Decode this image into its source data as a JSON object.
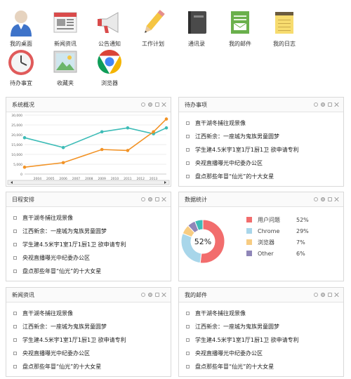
{
  "apps": [
    {
      "label": "我的桌面",
      "icon": "user-avatar-icon"
    },
    {
      "label": "新闻资讯",
      "icon": "newspaper-icon"
    },
    {
      "label": "公告通知",
      "icon": "megaphone-icon"
    },
    {
      "label": "工作计划",
      "icon": "pencil-icon"
    },
    {
      "label": "通讯录",
      "icon": "address-book-icon"
    },
    {
      "label": "我的邮件",
      "icon": "mail-icon"
    },
    {
      "label": "我的日志",
      "icon": "notepad-icon"
    },
    {
      "label": "待办事宜",
      "icon": "clock-icon"
    },
    {
      "label": "收藏夹",
      "icon": "picture-icon"
    },
    {
      "label": "浏览器",
      "icon": "chrome-icon"
    }
  ],
  "items": [
    "直干湖冬捕往观景像",
    "江西新余：一座城为鬼族男童圆梦",
    "学生建4.5米宇1室1厅1厨1卫 欲申请专利",
    "央视直播曝光中纪委办公区",
    "盘点那些年冒“仙光”的十大女星"
  ],
  "panels": {
    "overview": {
      "title": "系统概况"
    },
    "todo": {
      "title": "待办事项"
    },
    "schedule": {
      "title": "日程安排"
    },
    "stats": {
      "title": "数据统计"
    },
    "news": {
      "title": "新闻资讯"
    },
    "mail": {
      "title": "我的邮件"
    }
  },
  "chart_data": [
    {
      "type": "line",
      "x": [
        "2003",
        "2004",
        "2005",
        "2006",
        "2007",
        "2008",
        "2009",
        "2010",
        "2011",
        "2012",
        "2013",
        "2014"
      ],
      "series": [
        {
          "name": "",
          "color": "#3dbcb7",
          "values": [
            18500,
            null,
            null,
            13500,
            null,
            null,
            21500,
            null,
            23500,
            null,
            20500,
            23500
          ]
        },
        {
          "name": "",
          "color": "#f29326",
          "values": [
            3500,
            null,
            null,
            5800,
            null,
            null,
            12500,
            null,
            12000,
            null,
            21500,
            28000
          ]
        }
      ],
      "y_ticks": [
        "30,000",
        "25,000",
        "20,000",
        "15,000",
        "10,000",
        "5,000",
        "0"
      ],
      "x_ticks": [
        "2004",
        "2005",
        "2006",
        "2007",
        "2008",
        "2009",
        "2010",
        "2011",
        "2012",
        "2013"
      ],
      "ylim": [
        0,
        30000
      ],
      "grid": true,
      "title": "",
      "xlabel": "",
      "ylabel": ""
    },
    {
      "type": "pie",
      "center_label": "52%",
      "slices": [
        {
          "name": "用户问题",
          "value": 52,
          "label": "52%",
          "color": "#f26d6d"
        },
        {
          "name": "Chrome",
          "value": 29,
          "label": "29%",
          "color": "#a8d6ea"
        },
        {
          "name": "浏览器",
          "value": 7,
          "label": "7%",
          "color": "#f7cc82"
        },
        {
          "name": "Other",
          "value": 6,
          "label": "6%",
          "color": "#8f86b8"
        },
        {
          "name": "",
          "value": 6,
          "label": "",
          "color": "#3dbcb7"
        }
      ]
    }
  ]
}
